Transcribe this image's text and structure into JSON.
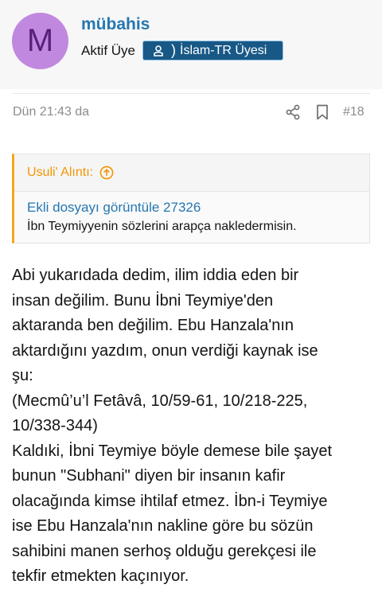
{
  "user": {
    "avatar_letter": "M",
    "avatar_color": "#c188e0",
    "name": "mübahis",
    "title": "Aktif Üye",
    "banner": "İslam-TR Üyesi"
  },
  "post": {
    "date": "Dün 21:43 da",
    "number": "#18",
    "share_icon": "share-icon",
    "bookmark_icon": "bookmark-icon"
  },
  "quote": {
    "header": "Usuli' Alıntı:",
    "link": "Ekli dosyayı görüntüle 27326",
    "text": "İbn Teymiyyenin sözlerini arapça nakledermisin."
  },
  "message": {
    "lines": [
      "Abi yukarıdada dedim, ilim iddia eden bir",
      "insan değilim. Bunu İbni Teymiye'den",
      "aktaranda ben değilim. Ebu Hanzala'nın",
      "aktardığını yazdım, onun verdiği kaynak ise",
      "şu:",
      "(Mecmû’u’l Fetâvâ, 10/59-61, 10/218-225,",
      "10/338-344)",
      "Kaldıki, İbni Teymiye böyle demese bile şayet",
      "bunun \"Subhani\" diyen bir insanın kafir",
      "olacağında kimse ihtilaf etmez. İbn-i Teymiye",
      "ise Ebu Hanzala'nın nakline göre bu sözün",
      "sahibini manen serhoş olduğu gerekçesi ile",
      "tekfir etmekten kaçınıyor."
    ]
  },
  "colors": {
    "link": "#2577b1",
    "quote_accent": "#f7a61c",
    "banner_bg": "#185886"
  }
}
